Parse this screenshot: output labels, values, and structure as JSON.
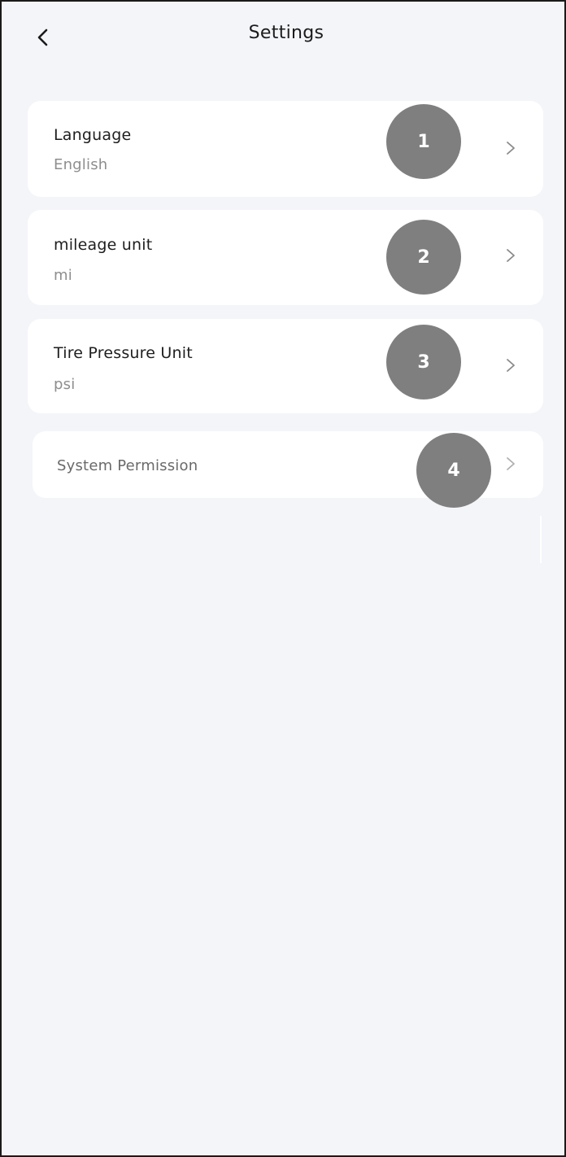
{
  "header": {
    "title": "Settings",
    "back_icon": "chevron-left-icon"
  },
  "settings": [
    {
      "label": "Language",
      "value": "English",
      "badge": "1",
      "icon": "chevron-right-icon"
    },
    {
      "label": "mileage unit",
      "value": "mi",
      "badge": "2",
      "icon": "chevron-right-icon"
    },
    {
      "label": "Tire Pressure Unit",
      "value": "psi",
      "badge": "3",
      "icon": "chevron-right-icon"
    },
    {
      "label": "System Permission",
      "badge": "4",
      "icon": "chevron-right-icon"
    }
  ],
  "colors": {
    "page_background": "#f4f5f9",
    "card_background": "#ffffff",
    "badge_background": "#7f7f7f",
    "label_text": "#1e1e1e",
    "value_text": "#8e8e8e"
  }
}
